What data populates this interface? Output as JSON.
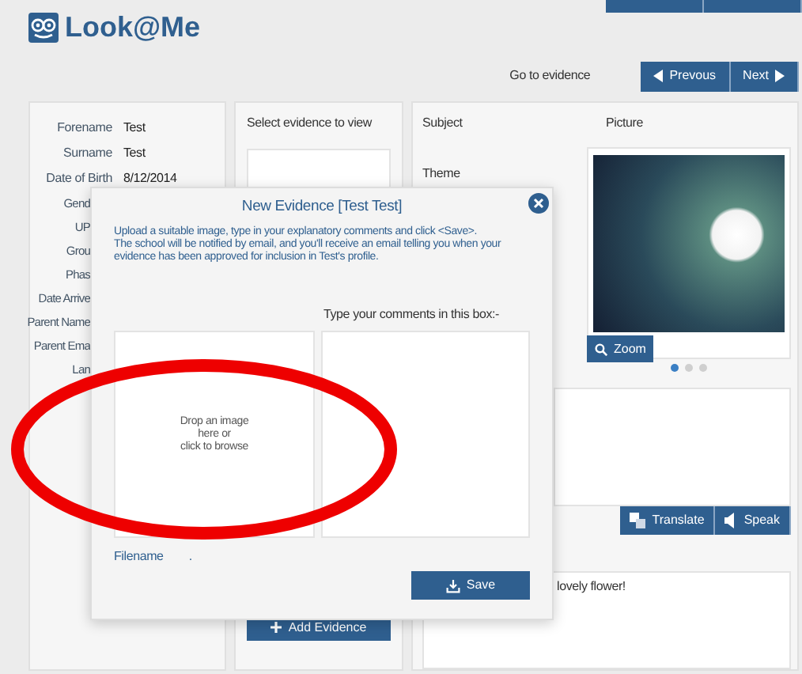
{
  "header": {
    "brand": "Look@Me"
  },
  "navigation": {
    "label": "Go to evidence",
    "buttons": [
      {
        "label": "Prevous",
        "kind": "prev"
      },
      {
        "label": "Next",
        "kind": "next"
      }
    ]
  },
  "student_details": [
    {
      "label": "Forename",
      "value": "Test"
    },
    {
      "label": "Surname",
      "value": "Test"
    },
    {
      "label": "Date of Birth",
      "value": "8/12/2014"
    },
    {
      "label": "Gend"
    },
    {
      "label": "UP"
    },
    {
      "label": "Grou"
    },
    {
      "label": "Phas"
    },
    {
      "label": "Date Arrive"
    },
    {
      "label": "Parent Name"
    },
    {
      "label": "Parent Ema"
    },
    {
      "label": "Lan"
    }
  ],
  "evidence_list": {
    "title": "Select evidence to view",
    "add_button": "Add Evidence"
  },
  "evidence_view": {
    "subject_label": "Subject",
    "theme_label": "Theme",
    "picture_label": "Picture",
    "zoom_button": "Zoom",
    "carousel_dots": [
      {
        "selected": true
      },
      {
        "selected": false
      },
      {
        "selected": false
      }
    ],
    "tool_buttons": [
      {
        "label": "Translate",
        "kind": "translate"
      },
      {
        "label": "Speak",
        "kind": "speak"
      }
    ],
    "comment": "lovely flower!"
  },
  "dialog": {
    "title": "New Evidence [Test Test]",
    "instructions": [
      "Upload a suitable image, type in your explanatory comments and click <Save>.",
      "The school will be notified by email, and you'll receive an email telling you when your evidence has been approved for inclusion in Test's profile."
    ],
    "comments_label": "Type your comments in this box:-",
    "drop_zone": [
      "Drop an image",
      "here or",
      "click to browse"
    ],
    "filename_label": "Filename",
    "filename_value": ".",
    "save_button": "Save"
  }
}
